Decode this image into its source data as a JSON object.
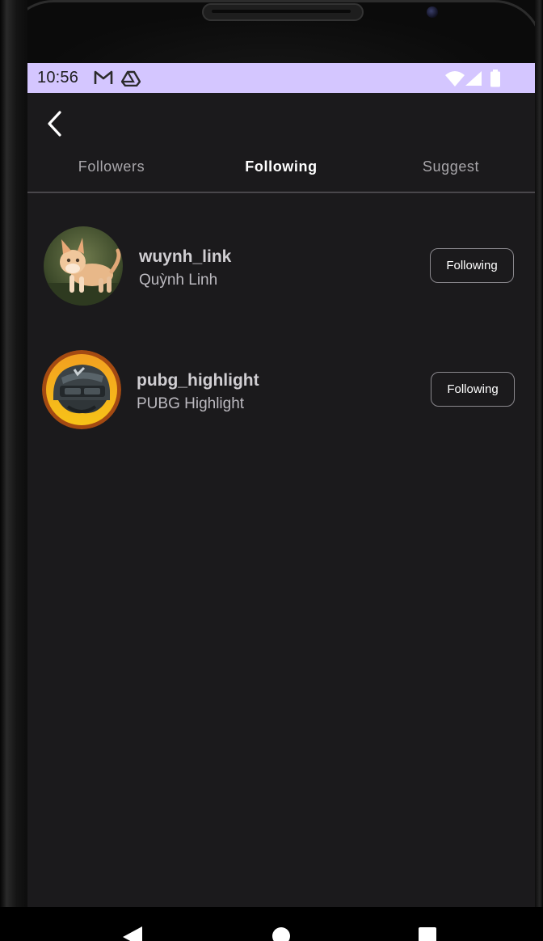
{
  "status_bar": {
    "time": "10:56",
    "icons": [
      "gmail-icon",
      "drive-icon",
      "wifi-icon",
      "signal-icon",
      "battery-icon"
    ],
    "background": "#d4c6ff"
  },
  "header": {
    "back_icon": "back-arrow-icon"
  },
  "tabs": [
    {
      "label": "Followers",
      "active": false
    },
    {
      "label": "Following",
      "active": true
    },
    {
      "label": "Suggest",
      "active": false
    }
  ],
  "users": [
    {
      "username": "wuynh_link",
      "full_name": "Quỳnh Linh",
      "avatar": "cat-photo",
      "button_label": "Following"
    },
    {
      "username": "pubg_highlight",
      "full_name": "PUBG Highlight",
      "avatar": "helmet-logo",
      "button_label": "Following"
    }
  ],
  "navigation": {
    "icons": [
      "nav-back-icon",
      "nav-home-icon",
      "nav-recents-icon"
    ]
  },
  "colors": {
    "screen_background": "#1b1a1c",
    "active_tab": "#ffffff",
    "inactive_tab": "#a9a7ab",
    "status_bar": "#d4c6ff"
  }
}
